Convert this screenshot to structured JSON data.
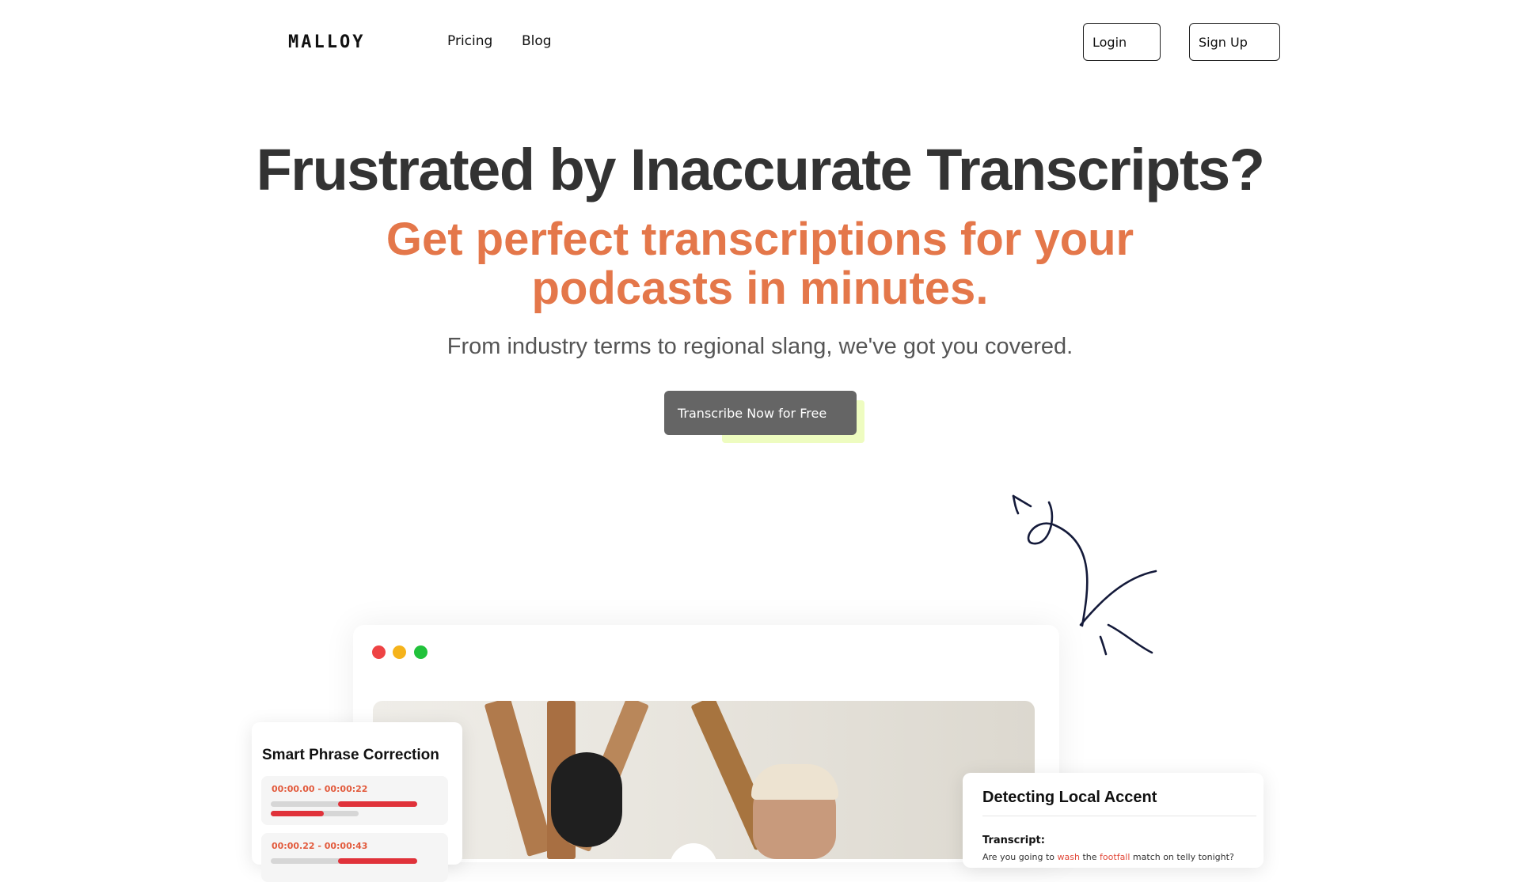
{
  "nav": {
    "logo": "MALLOY",
    "links": [
      "Pricing",
      "Blog"
    ],
    "login_label": "Login",
    "signup_label": "Sign Up"
  },
  "hero": {
    "title": "Frustrated by Inaccurate Transcripts?",
    "subtitle": "Get perfect transcriptions for your podcasts in minutes.",
    "tagline": "From industry terms to regional slang, we've got you covered.",
    "cta_label": "Transcribe Now for Free"
  },
  "window": {
    "traffic_colors": [
      "#ee4344",
      "#f5b31b",
      "#21c23b"
    ]
  },
  "smart_card": {
    "title": "Smart Phrase Correction",
    "segments": [
      {
        "time": "00:00.00 - 00:00:22"
      },
      {
        "time": "00:00.22 - 00:00:43"
      }
    ]
  },
  "accent_card": {
    "title": "Detecting Local Accent",
    "transcript_label": "Transcript:",
    "transcript_words": [
      "Are you going to ",
      "wash",
      " the ",
      "footfall",
      " match on telly tonight?"
    ]
  },
  "colors": {
    "accent": "#e4774a",
    "highlight": "#e2493a"
  }
}
